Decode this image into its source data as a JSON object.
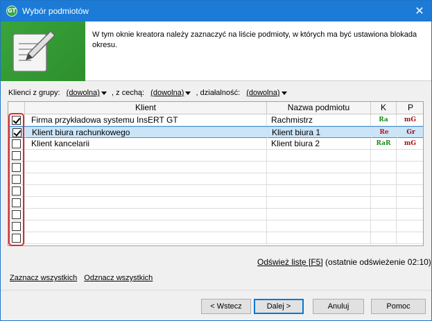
{
  "window": {
    "title": "Wybór podmiotów",
    "app_icon_text": "GT",
    "close_glyph": "✕"
  },
  "header": {
    "description": "W tym oknie kreatora należy zaznaczyć na liście podmioty, w których ma być ustawiona blokada okresu.",
    "banner_icon": "pencil-note-icon",
    "banner_color": "#3aa43a"
  },
  "filters": {
    "group_label": "Klienci z grupy:",
    "group_value": "(dowolna)",
    "feature_label": ", z cechą:",
    "feature_value": "(dowolna)",
    "activity_label": ", działalność:",
    "activity_value": "(dowolna)"
  },
  "table": {
    "columns": [
      "",
      "Klient",
      "Nazwa podmiotu",
      "K",
      "P"
    ],
    "rows": [
      {
        "checked": true,
        "client": "Firma przykładowa systemu InsERT GT",
        "entity": "Rachmistrz",
        "k": "Ra",
        "k_color": "#1a8a1a",
        "p": "mG",
        "p_color": "#a01010"
      },
      {
        "checked": true,
        "client": "Klient biura rachunkowego",
        "entity": "Klient biura 1",
        "k": "Re",
        "k_color": "#d01010",
        "p": "Gr",
        "p_color": "#8a1010",
        "selected": true
      },
      {
        "checked": false,
        "client": "Klient kancelarii",
        "entity": "Klient biura 2",
        "k": "RaR",
        "k_color": "#1a8a1a",
        "p": "mG",
        "p_color": "#a01010"
      }
    ],
    "empty_rows": 8
  },
  "refresh": {
    "link": "Odśwież listę [F5]",
    "info": "(ostatnie odświeżenie 02:10)"
  },
  "links": {
    "select_all": "Zaznacz wszystkich",
    "deselect_all": "Odznacz wszystkich"
  },
  "buttons": {
    "back": "< Wstecz",
    "next": "Dalej >",
    "cancel": "Anuluj",
    "help": "Pomoc"
  },
  "colors": {
    "titlebar": "#1b7bd6",
    "highlight": "#e8252a",
    "selection": "#cce4f7"
  }
}
